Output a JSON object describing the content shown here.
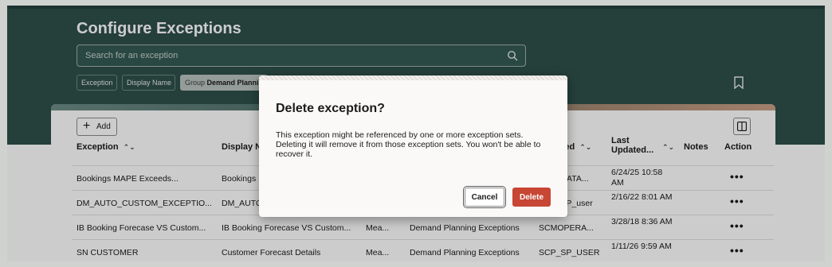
{
  "page": {
    "title": "Configure Exceptions"
  },
  "search": {
    "placeholder": "Search for an exception"
  },
  "filters": {
    "exception": "Exception",
    "display_name": "Display Name",
    "group_prefix": "Group",
    "group_value": "Demand Planning Exceptions"
  },
  "toolbar": {
    "add_label": "Add"
  },
  "table": {
    "headers": {
      "exception": "Exception",
      "display_name": "Display Name",
      "modified_by": "Modified",
      "last_updated": "Last Updated...",
      "notes": "Notes",
      "action": "Action"
    },
    "rows": [
      {
        "exception": "Bookings MAPE Exceeds...",
        "display_name": "Bookings",
        "type": "",
        "group": "",
        "modified_by": "CSP_DATA...",
        "last_updated": "6/24/25 10:58 AM",
        "action": "•••"
      },
      {
        "exception": "DM_AUTO_CUSTOM_EXCEPTIO...",
        "display_name": "DM_AUTO",
        "type": "",
        "group": "",
        "modified_by": "SCP_SP_user",
        "last_updated": "2/16/22 8:01 AM",
        "action": "•••"
      },
      {
        "exception": "IB Booking Forecase VS Custom...",
        "display_name": "IB Booking Forecase VS Custom...",
        "type": "Mea...",
        "group": "Demand Planning Exceptions",
        "modified_by": "SCMOPERA...",
        "last_updated": "3/28/18 8:36 AM",
        "action": "•••"
      },
      {
        "exception": "SN CUSTOMER",
        "display_name": "Customer Forecast Details",
        "type": "Mea...",
        "group": "Demand Planning Exceptions",
        "modified_by": "SCP_SP_USER",
        "last_updated": "1/11/26 9:59 AM",
        "action": "•••"
      }
    ]
  },
  "dialog": {
    "title": "Delete exception?",
    "body": "This exception might be referenced by one or more exception sets. Deleting it will remove it from those exception sets. You won't be able to recover it.",
    "cancel_label": "Cancel",
    "delete_label": "Delete"
  },
  "colors": {
    "header_bg": "#2f4f4a",
    "danger": "#c74634"
  }
}
